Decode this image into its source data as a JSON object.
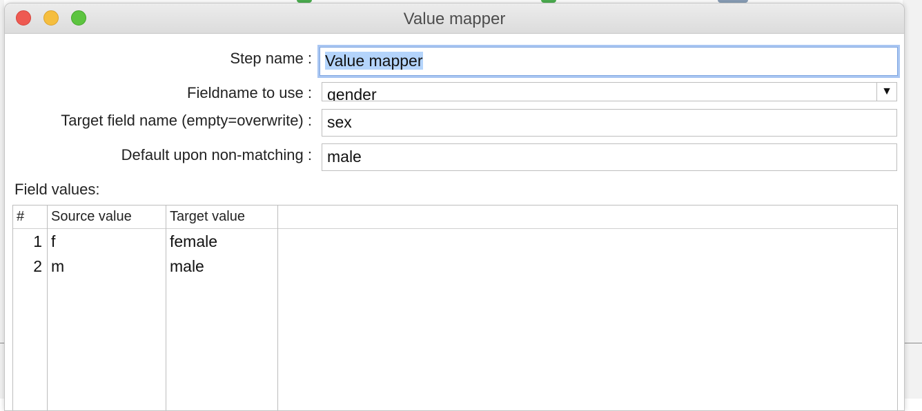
{
  "window": {
    "title": "Value mapper"
  },
  "form": {
    "step_name_label": "Step name :",
    "step_name_value": "Value mapper",
    "fieldname_label": "Fieldname to use :",
    "fieldname_value": "gender",
    "target_label": "Target field name (empty=overwrite) :",
    "target_value": "sex",
    "default_label": "Default upon non-matching :",
    "default_value": "male",
    "field_values_label": "Field values:"
  },
  "table": {
    "columns": [
      "#",
      "Source value",
      "Target value"
    ],
    "rows": [
      {
        "num": "1",
        "source": "f",
        "target": "female"
      },
      {
        "num": "2",
        "source": "m",
        "target": "male"
      }
    ]
  },
  "icons": {
    "dropdown": "triangle-down-icon"
  },
  "colors": {
    "close": "#ee5a52",
    "minimize": "#f5be3f",
    "zoom": "#5cc43f",
    "focus_ring": "#a9c6f2",
    "selection": "#b4d4fb"
  }
}
